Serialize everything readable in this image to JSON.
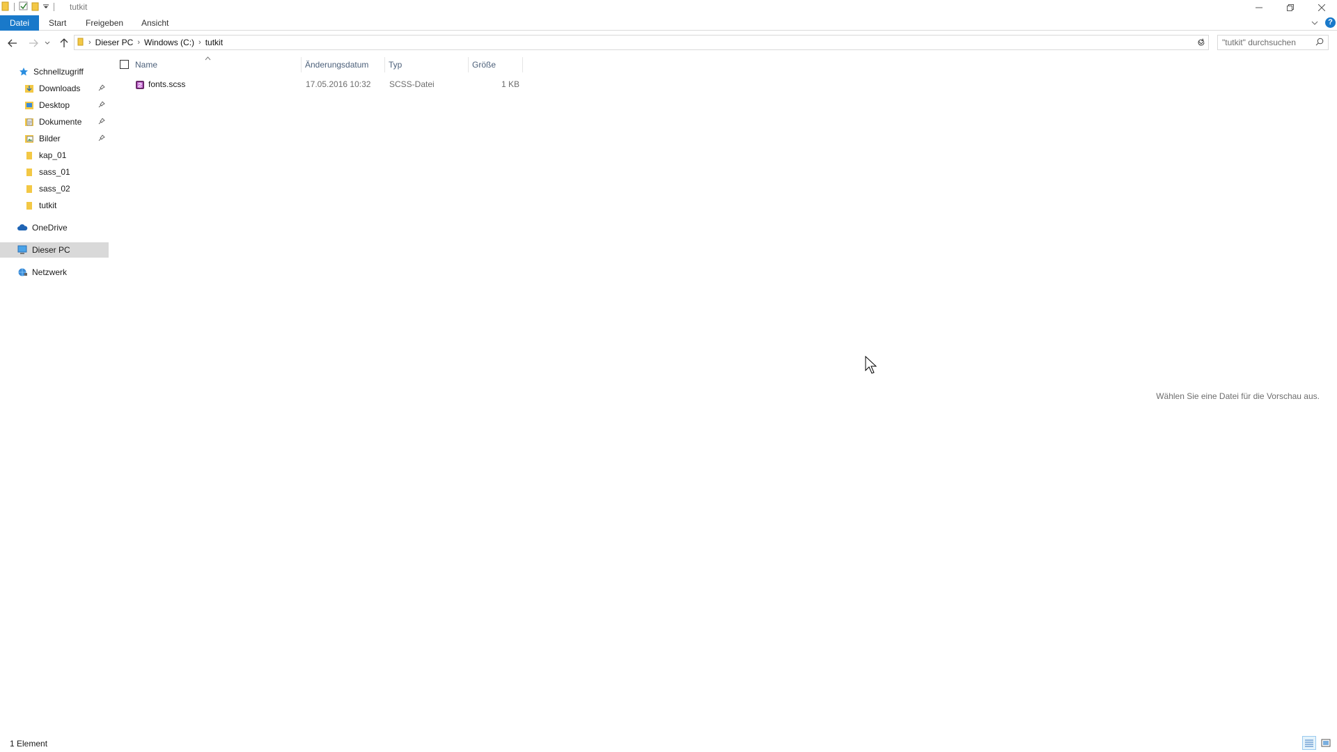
{
  "window": {
    "title": "tutkit",
    "controls": [
      "minimize",
      "restore",
      "close"
    ]
  },
  "ribbon": {
    "tabs": [
      {
        "label": "Datei",
        "active": true
      },
      {
        "label": "Start"
      },
      {
        "label": "Freigeben"
      },
      {
        "label": "Ansicht"
      }
    ],
    "help_label": "?"
  },
  "address": {
    "crumbs": [
      "Dieser PC",
      "Windows (C:)",
      "tutkit"
    ]
  },
  "search": {
    "placeholder": "\"tutkit\" durchsuchen"
  },
  "sidebar": {
    "quick_access": {
      "label": "Schnellzugriff",
      "icon": "star-icon"
    },
    "items": [
      {
        "label": "Downloads",
        "icon": "downloads-folder-icon",
        "pinned": true
      },
      {
        "label": "Desktop",
        "icon": "desktop-folder-icon",
        "pinned": true
      },
      {
        "label": "Dokumente",
        "icon": "documents-folder-icon",
        "pinned": true
      },
      {
        "label": "Bilder",
        "icon": "pictures-folder-icon",
        "pinned": true
      },
      {
        "label": "kap_01",
        "icon": "folder-icon",
        "pinned": false
      },
      {
        "label": "sass_01",
        "icon": "folder-icon",
        "pinned": false
      },
      {
        "label": "sass_02",
        "icon": "folder-icon",
        "pinned": false
      },
      {
        "label": "tutkit",
        "icon": "folder-icon",
        "pinned": false
      }
    ],
    "roots": [
      {
        "label": "OneDrive",
        "icon": "cloud-icon",
        "selected": false
      },
      {
        "label": "Dieser PC",
        "icon": "computer-icon",
        "selected": true
      },
      {
        "label": "Netzwerk",
        "icon": "network-icon",
        "selected": false
      }
    ]
  },
  "columns": {
    "name": "Name",
    "date": "Änderungsdatum",
    "type": "Typ",
    "size": "Größe"
  },
  "files": [
    {
      "name": "fonts.scss",
      "date": "17.05.2016 10:32",
      "type": "SCSS-Datei",
      "size": "1 KB",
      "icon": "scss-file-icon"
    }
  ],
  "preview": {
    "message": "Wählen Sie eine Datei für die Vorschau aus."
  },
  "status": {
    "count": "1 Element"
  },
  "colors": {
    "accent": "#1979ca",
    "selected_bg": "#d9d9d9",
    "column_header": "#4c607a",
    "folder": "#f3c845"
  }
}
